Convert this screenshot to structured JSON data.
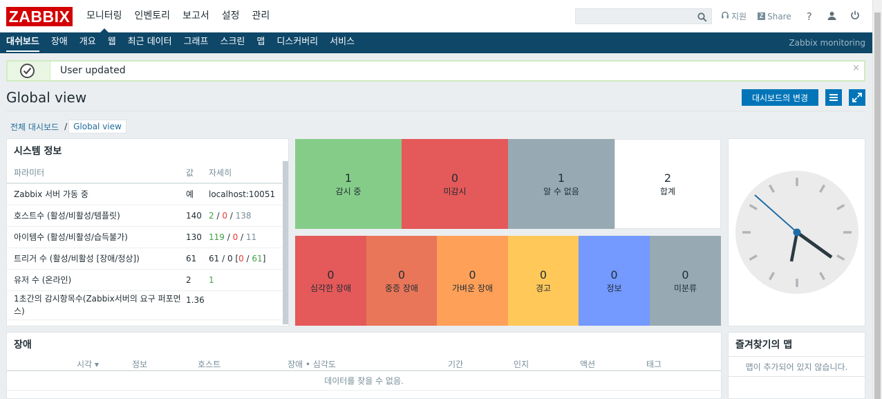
{
  "header": {
    "logo": "ZABBIX",
    "menu": [
      "모니터링",
      "인벤토리",
      "보고서",
      "설정",
      "관리"
    ],
    "search_placeholder": "",
    "support_label": "지원",
    "share_label": "Share",
    "help_label": "?"
  },
  "submenu": {
    "items": [
      "대쉬보드",
      "장애",
      "개요",
      "웹",
      "최근 데이터",
      "그래프",
      "스크린",
      "맵",
      "디스커버리",
      "서비스"
    ],
    "brand": "Zabbix monitoring"
  },
  "message": {
    "text": "User updated",
    "close": "×"
  },
  "page": {
    "title": "Global view",
    "edit_button": "대시보드의 변경"
  },
  "breadcrumb": {
    "all": "전체 대시보드",
    "separator": "/",
    "current": "Global view"
  },
  "system_info": {
    "title": "시스템 정보",
    "columns": [
      "파라미터",
      "값",
      "자세히"
    ],
    "rows": [
      {
        "param": "Zabbix 서버 가동 중",
        "value": "예",
        "details": "localhost:10051"
      },
      {
        "param": "호스트수 (활성/비활성/템플릿)",
        "value": "140",
        "d1": "2",
        "d2": "0",
        "d3": "138"
      },
      {
        "param": "아이템수 (활성/비활성/습득불가)",
        "value": "130",
        "d1": "119",
        "d2": "0",
        "d3": "11"
      },
      {
        "param": "트리거 수 (활성/비활성 [장애/정상])",
        "value": "61",
        "d1": "61",
        "d2": "0",
        "d3": "0",
        "d4": "61"
      },
      {
        "param": "유저 수 (온라인)",
        "value": "2",
        "d1": "1"
      },
      {
        "param": "1초간의 감시항목수(Zabbix서버의 요구 퍼포먼스)",
        "value": "1.36"
      }
    ]
  },
  "host_status": [
    {
      "count": "1",
      "label": "감시 중",
      "color": "#86cc89"
    },
    {
      "count": "0",
      "label": "미감시",
      "color": "#e45959"
    },
    {
      "count": "1",
      "label": "알 수 없음",
      "color": "#97aab3"
    },
    {
      "count": "2",
      "label": "합계",
      "color": "#ffffff"
    }
  ],
  "severity": [
    {
      "count": "0",
      "label": "심각한 장애",
      "color": "#e45959"
    },
    {
      "count": "0",
      "label": "중증 장애",
      "color": "#e97659"
    },
    {
      "count": "0",
      "label": "가벼운 장애",
      "color": "#ffa059"
    },
    {
      "count": "0",
      "label": "경고",
      "color": "#ffc859"
    },
    {
      "count": "0",
      "label": "정보",
      "color": "#7499ff"
    },
    {
      "count": "0",
      "label": "미분류",
      "color": "#97aab3"
    }
  ],
  "problems": {
    "title": "장애",
    "columns": [
      "시각 ▾",
      "정보",
      "호스트",
      "장애 • 심각도",
      "기간",
      "인지",
      "액션",
      "태그"
    ],
    "empty": "데이터를 찾을 수 없음."
  },
  "favorite_maps": {
    "title": "즐겨찾기의 맵",
    "empty": "맵이 추가되어 있지 않습니다."
  }
}
